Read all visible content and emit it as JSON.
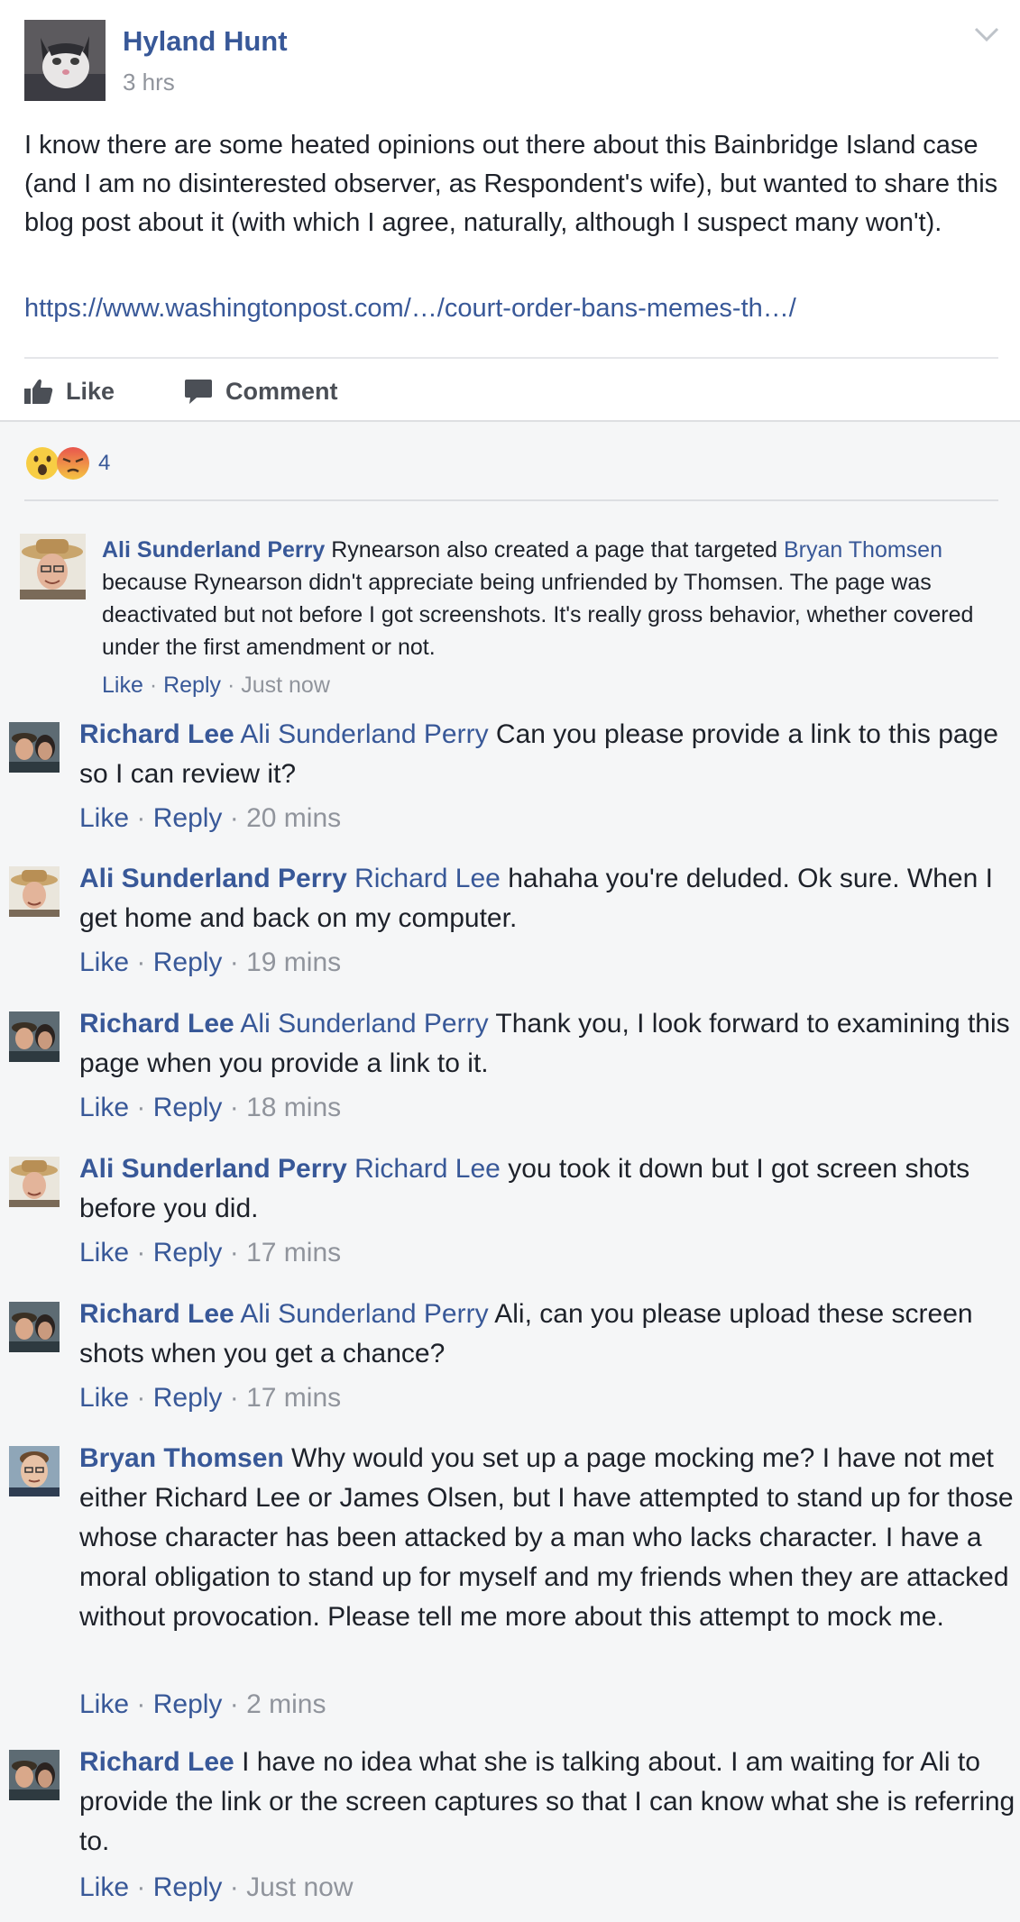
{
  "post": {
    "author": "Hyland Hunt",
    "time": "3 hrs",
    "text": "I know there are some heated opinions out there about this Bainbridge Island case (and I am no disinterested observer, as Respondent's wife), but wanted to share this blog post about it (with which I agree, naturally, although I suspect many won't).",
    "link": "https://www.washingtonpost.com/…/court-order-bans-memes-th…/",
    "like_label": "Like",
    "comment_label": "Comment",
    "reaction_count": "4"
  },
  "comments": [
    {
      "author": "Ali Sunderland Perry",
      "text_a": " Rynearson also created a page that targeted ",
      "mention": "Bryan Thomsen",
      "text_b": " because Rynearson didn't appreciate being unfriended by Thomsen. The page was deactivated but not before I got screenshots. It's really gross behavior, whether covered under the first amendment or not.",
      "like": "Like",
      "reply": "Reply",
      "sep": " · ",
      "time": "Just now"
    },
    {
      "author": "Richard Lee",
      "mention": "Ali Sunderland Perry",
      "text": " Can you please provide a link to this page so I can review it?",
      "like": "Like",
      "reply": "Reply",
      "sep": " · ",
      "time": "20 mins"
    },
    {
      "author": "Ali Sunderland Perry",
      "mention": "Richard Lee",
      "text": " hahaha you're deluded. Ok sure. When I get home and back on my computer.",
      "like": "Like",
      "reply": "Reply",
      "sep": " · ",
      "time": "19 mins"
    },
    {
      "author": "Richard Lee",
      "mention": "Ali Sunderland Perry",
      "text": " Thank you, I look forward to examining this page when you provide a link to it.",
      "like": "Like",
      "reply": "Reply",
      "sep": " · ",
      "time": "18 mins"
    },
    {
      "author": "Ali Sunderland Perry",
      "mention": "Richard Lee",
      "text": " you took it down but I got screen shots before you did.",
      "like": "Like",
      "reply": "Reply",
      "sep": " · ",
      "time": "17 mins"
    },
    {
      "author": "Richard Lee",
      "mention": "Ali Sunderland Perry",
      "text": " Ali, can you please upload these screen shots when you get a chance?",
      "like": "Like",
      "reply": "Reply",
      "sep": " · ",
      "time": "17 mins"
    },
    {
      "author": "Bryan Thomsen",
      "text": " Why would you set up a page mocking me? I have not met either Richard Lee or James Olsen, but I have attempted to stand up for those whose character has been attacked by a man who lacks character. I have a moral obligation to stand up for myself and my friends when they are attacked without provocation. Please tell me more about this attempt to mock me.",
      "like": "Like",
      "reply": "Reply",
      "sep": " · ",
      "time": "2 mins"
    },
    {
      "author": "Richard Lee",
      "text": " I have no idea what she is talking about. I am waiting for Ali to provide the link or the screen captures so that I can know what she is referring to.",
      "like": "Like",
      "reply": "Reply",
      "sep": " · ",
      "time": "Just now"
    }
  ],
  "icons": {
    "post_menu": "chevron-down-icon",
    "like": "thumbs-up-icon",
    "comment": "speech-bubble-icon",
    "reaction_wow": "wow-face-icon",
    "reaction_angry": "angry-face-icon"
  },
  "colors": {
    "link_blue": "#385898",
    "muted_gray": "#90949c",
    "text": "#1d2129",
    "comments_bg": "#f5f6f7"
  }
}
